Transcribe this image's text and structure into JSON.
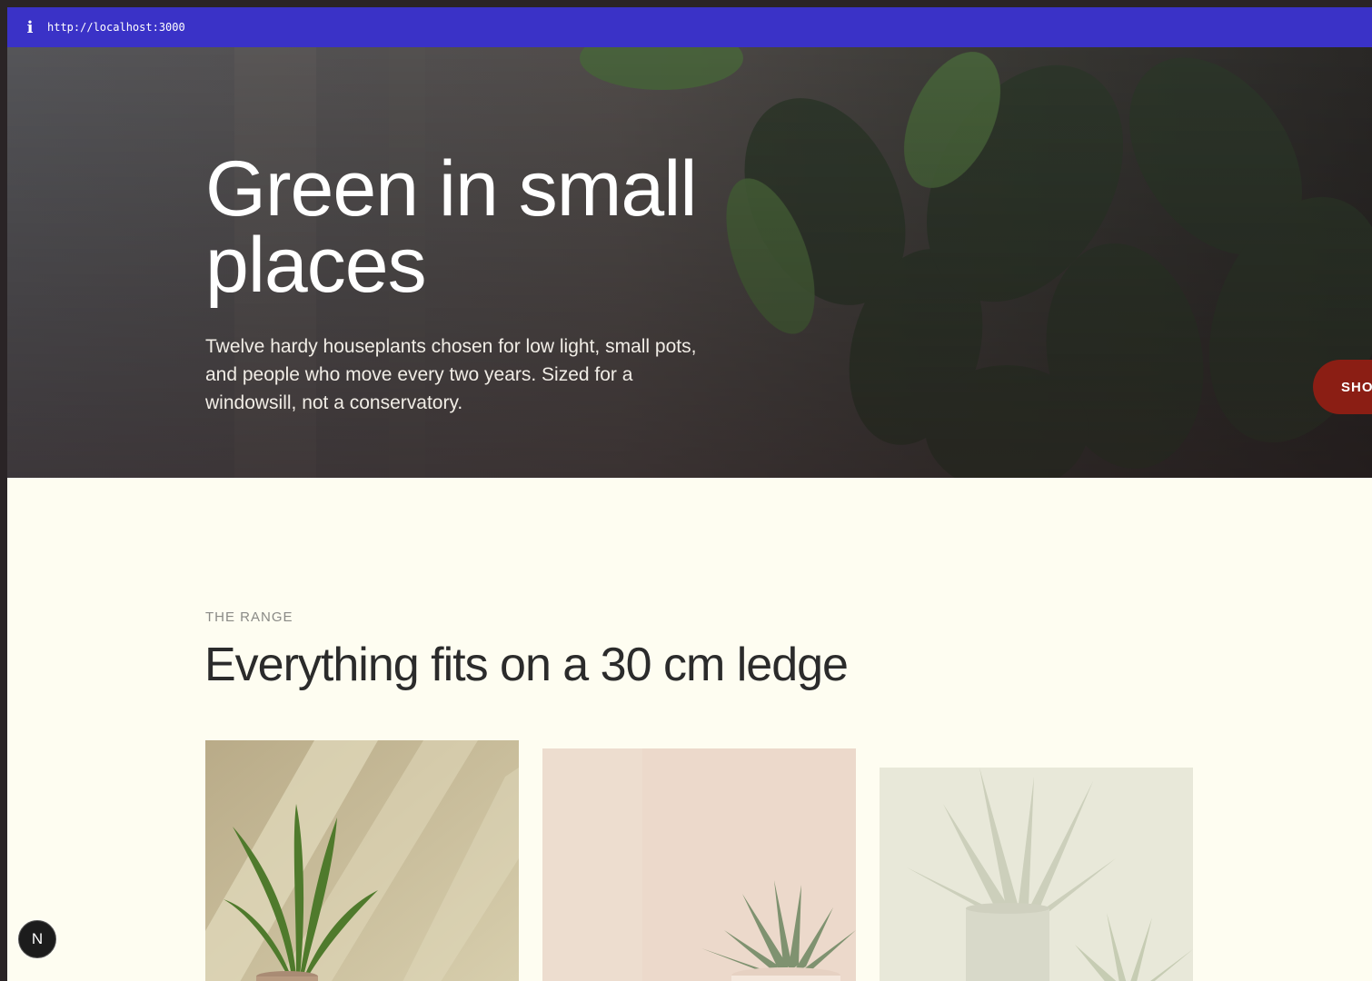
{
  "browser": {
    "url": "http://localhost:3000",
    "info_icon": "i"
  },
  "hero": {
    "title": "Green in small places",
    "subtitle": "Twelve hardy houseplants chosen for low light, small pots, and people who move every two years. Sized for a windowsill, not a conservatory.",
    "shop_button_label": "SHOP"
  },
  "range": {
    "eyebrow": "THE RANGE",
    "title": "Everything fits on a 30 cm ledge"
  },
  "dev_badge": {
    "label": "N"
  },
  "colors": {
    "url_bar": "#3a32c7",
    "page_background": "#fefdf1",
    "shop_button": "#8b1e14",
    "heading_text": "#2b2b2b"
  }
}
